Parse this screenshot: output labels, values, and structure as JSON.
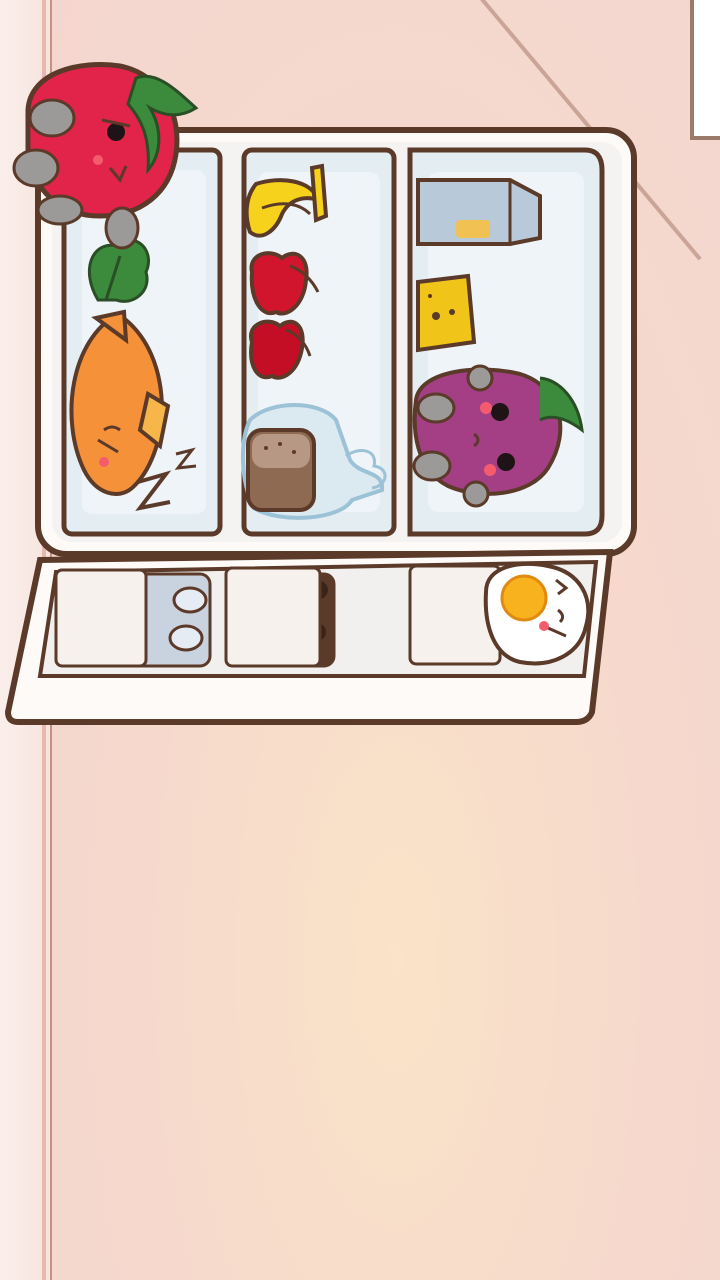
{
  "scene": {
    "name": "fridge",
    "colors": {
      "outline": "#5b3a29",
      "fridge_body": "#fdfaf8",
      "shelf_interior": "#e4edf2",
      "tomato": "#e2234a",
      "apple": "#d1152c",
      "banana": "#f7d21c",
      "fish": "#f59138",
      "grape": "#a43f85",
      "leaf": "#3c8a3b"
    }
  },
  "fridge": {
    "compartments": [
      {
        "id": "left",
        "items": [
          "sleeping-fish-icon",
          "leafy-greens-icon"
        ],
        "text": "Z z"
      },
      {
        "id": "middle",
        "items": [
          "banana-icon",
          "apple-icon",
          "apple-icon",
          "bread-in-bag-icon"
        ]
      },
      {
        "id": "right",
        "items": [
          "milk-carton-icon",
          "cheese-icon",
          "grape-character-icon"
        ]
      }
    ],
    "door_shelf_items": [
      "milk-bottles-icon",
      "milk-bottles-icon",
      "cola-bottles-icon",
      "fried-egg-character-icon"
    ]
  },
  "characters": [
    {
      "name": "tomato-character-icon"
    },
    {
      "name": "grape-character-icon"
    },
    {
      "name": "fried-egg-character-icon"
    }
  ]
}
